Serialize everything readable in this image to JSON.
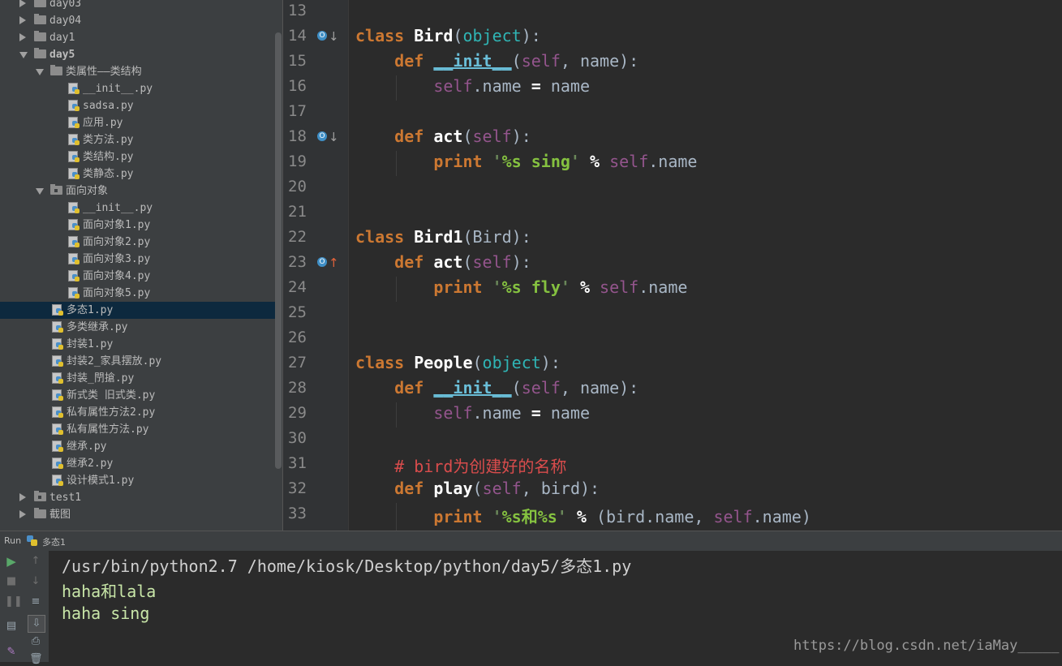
{
  "project_tree": [
    {
      "label": "day03",
      "level": 1,
      "type": "folder",
      "expanded": false
    },
    {
      "label": "day04",
      "level": 1,
      "type": "folder",
      "expanded": false
    },
    {
      "label": "day1",
      "level": 1,
      "type": "folder",
      "expanded": false
    },
    {
      "label": "day5",
      "level": 1,
      "type": "folder",
      "expanded": true,
      "bold": true
    },
    {
      "label": "类属性——类结构",
      "level": 2,
      "type": "folder",
      "expanded": true
    },
    {
      "label": "__init__.py",
      "level": 3,
      "type": "file"
    },
    {
      "label": "sadsa.py",
      "level": 3,
      "type": "file"
    },
    {
      "label": "应用.py",
      "level": 3,
      "type": "file"
    },
    {
      "label": "类方法.py",
      "level": 3,
      "type": "file"
    },
    {
      "label": "类结构.py",
      "level": 3,
      "type": "file"
    },
    {
      "label": "类静态.py",
      "level": 3,
      "type": "file"
    },
    {
      "label": "面向对象",
      "level": 2,
      "type": "package",
      "expanded": true
    },
    {
      "label": "__init__.py",
      "level": 3,
      "type": "file"
    },
    {
      "label": "面向对象1.py",
      "level": 3,
      "type": "file"
    },
    {
      "label": "面向对象2.py",
      "level": 3,
      "type": "file"
    },
    {
      "label": "面向对象3.py",
      "level": 3,
      "type": "file"
    },
    {
      "label": "面向对象4.py",
      "level": 3,
      "type": "file"
    },
    {
      "label": "面向对象5.py",
      "level": 3,
      "type": "file"
    },
    {
      "label": "多态1.py",
      "level": 2,
      "type": "file",
      "selected": true
    },
    {
      "label": "多类继承.py",
      "level": 2,
      "type": "file"
    },
    {
      "label": "封装1.py",
      "level": 2,
      "type": "file"
    },
    {
      "label": "封装2_家具摆放.py",
      "level": 2,
      "type": "file"
    },
    {
      "label": "封装_閅搶.py",
      "level": 2,
      "type": "file"
    },
    {
      "label": "新式类 旧式类.py",
      "level": 2,
      "type": "file"
    },
    {
      "label": "私有属性方法2.py",
      "level": 2,
      "type": "file"
    },
    {
      "label": "私有属性方法.py",
      "level": 2,
      "type": "file"
    },
    {
      "label": "继承.py",
      "level": 2,
      "type": "file"
    },
    {
      "label": "继承2.py",
      "level": 2,
      "type": "file"
    },
    {
      "label": "设计模式1.py",
      "level": 2,
      "type": "file"
    },
    {
      "label": "test1",
      "level": 1,
      "type": "package",
      "expanded": false
    },
    {
      "label": "截图",
      "level": 1,
      "type": "folder",
      "expanded": false
    }
  ],
  "editor": {
    "lines": [
      {
        "n": "13",
        "segs": []
      },
      {
        "n": "14",
        "marker": "override-down",
        "segs": [
          [
            "kw",
            "class "
          ],
          [
            "cls",
            "Bird"
          ],
          [
            "p",
            "("
          ],
          [
            "builtin",
            "object"
          ],
          [
            "p",
            "):"
          ]
        ]
      },
      {
        "n": "15",
        "segs": [
          [
            "p",
            "    "
          ],
          [
            "kw",
            "def "
          ],
          [
            "magic",
            "__init__"
          ],
          [
            "p",
            "("
          ],
          [
            "selfc",
            "self"
          ],
          [
            "p",
            ", name):"
          ]
        ]
      },
      {
        "n": "16",
        "segs": [
          [
            "p",
            "        "
          ],
          [
            "selfc",
            "self"
          ],
          [
            "p",
            ".name "
          ],
          [
            "op",
            "="
          ],
          [
            "p",
            " name"
          ]
        ]
      },
      {
        "n": "17",
        "segs": []
      },
      {
        "n": "18",
        "marker": "override-down",
        "segs": [
          [
            "p",
            "    "
          ],
          [
            "kw",
            "def "
          ],
          [
            "fn",
            "act"
          ],
          [
            "p",
            "("
          ],
          [
            "selfc",
            "self"
          ],
          [
            "p",
            "):"
          ]
        ]
      },
      {
        "n": "19",
        "segs": [
          [
            "p",
            "        "
          ],
          [
            "kw",
            "print "
          ],
          [
            "str",
            "'"
          ],
          [
            "strfmt",
            "%s sing"
          ],
          [
            "str",
            "'"
          ],
          [
            "op",
            " % "
          ],
          [
            "selfc",
            "self"
          ],
          [
            "p",
            ".name"
          ]
        ]
      },
      {
        "n": "20",
        "segs": []
      },
      {
        "n": "21",
        "segs": []
      },
      {
        "n": "22",
        "segs": [
          [
            "kw",
            "class "
          ],
          [
            "cls",
            "Bird1"
          ],
          [
            "p",
            "(Bird):"
          ]
        ]
      },
      {
        "n": "23",
        "marker": "override-up",
        "segs": [
          [
            "p",
            "    "
          ],
          [
            "kw",
            "def "
          ],
          [
            "fn",
            "act"
          ],
          [
            "p",
            "("
          ],
          [
            "selfc",
            "self"
          ],
          [
            "p",
            "):"
          ]
        ]
      },
      {
        "n": "24",
        "segs": [
          [
            "p",
            "        "
          ],
          [
            "kw",
            "print "
          ],
          [
            "str",
            "'"
          ],
          [
            "strfmt",
            "%s fly"
          ],
          [
            "str",
            "'"
          ],
          [
            "op",
            " % "
          ],
          [
            "selfc",
            "self"
          ],
          [
            "p",
            ".name"
          ]
        ]
      },
      {
        "n": "25",
        "segs": []
      },
      {
        "n": "26",
        "segs": []
      },
      {
        "n": "27",
        "segs": [
          [
            "kw",
            "class "
          ],
          [
            "cls",
            "People"
          ],
          [
            "p",
            "("
          ],
          [
            "builtin",
            "object"
          ],
          [
            "p",
            "):"
          ]
        ]
      },
      {
        "n": "28",
        "segs": [
          [
            "p",
            "    "
          ],
          [
            "kw",
            "def "
          ],
          [
            "magic",
            "__init__"
          ],
          [
            "p",
            "("
          ],
          [
            "selfc",
            "self"
          ],
          [
            "p",
            ", name):"
          ]
        ]
      },
      {
        "n": "29",
        "segs": [
          [
            "p",
            "        "
          ],
          [
            "selfc",
            "self"
          ],
          [
            "p",
            ".name "
          ],
          [
            "op",
            "="
          ],
          [
            "p",
            " name"
          ]
        ]
      },
      {
        "n": "30",
        "segs": []
      },
      {
        "n": "31",
        "segs": [
          [
            "p",
            "    "
          ],
          [
            "cmt",
            "# bird为创建好的名称"
          ]
        ]
      },
      {
        "n": "32",
        "segs": [
          [
            "p",
            "    "
          ],
          [
            "kw",
            "def "
          ],
          [
            "fn",
            "play"
          ],
          [
            "p",
            "("
          ],
          [
            "selfc",
            "self"
          ],
          [
            "p",
            ", bird):"
          ]
        ]
      },
      {
        "n": "33",
        "segs": [
          [
            "p",
            "        "
          ],
          [
            "kw",
            "print "
          ],
          [
            "str",
            "'"
          ],
          [
            "strfmt",
            "%s和%s"
          ],
          [
            "str",
            "'"
          ],
          [
            "op",
            " % "
          ],
          [
            "p",
            "(bird.name, "
          ],
          [
            "selfc",
            "self"
          ],
          [
            "p",
            ".name)"
          ]
        ]
      }
    ]
  },
  "run": {
    "label": "Run",
    "tab": "多态1",
    "console": [
      {
        "text": "/usr/bin/python2.7 /home/kiosk/Desktop/python/day5/多态1.py",
        "kind": "cmd"
      },
      {
        "text": "haha和lala",
        "kind": "out"
      },
      {
        "text": "haha sing",
        "kind": "out"
      }
    ]
  },
  "watermark": "https://blog.csdn.net/iaMay_____",
  "colors": {
    "keyword": "#cc7832",
    "self": "#94558d",
    "string": "#6a8759",
    "comment": "#d94c4c",
    "selection": "#0d293e"
  }
}
